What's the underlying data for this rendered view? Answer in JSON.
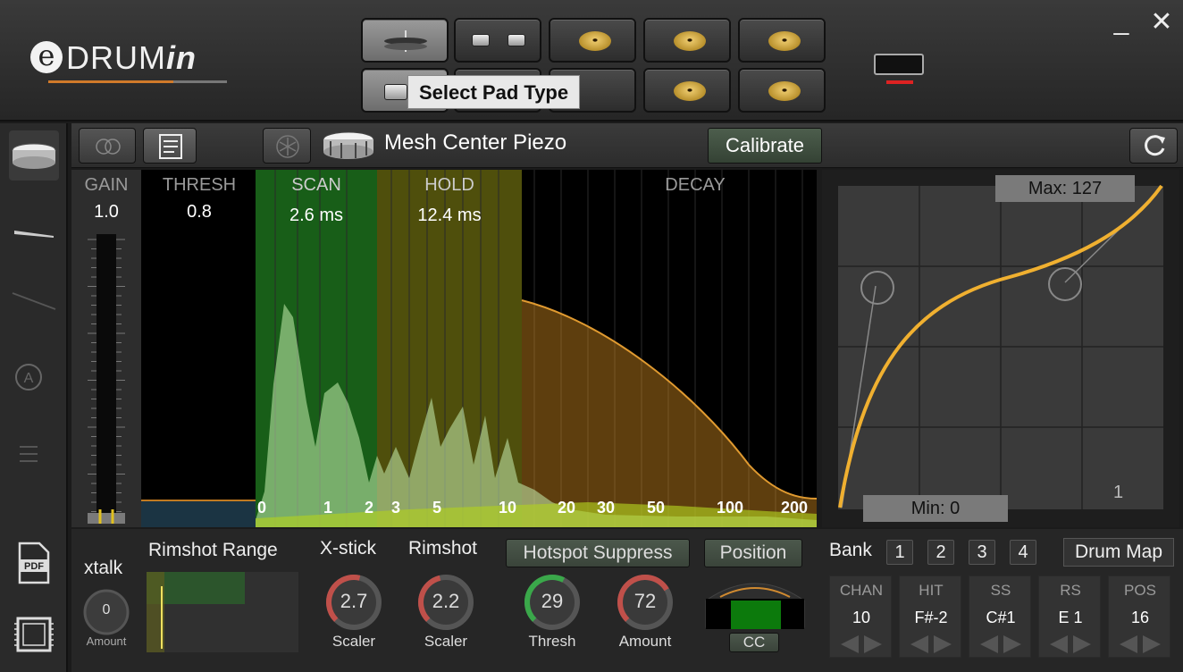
{
  "header": {
    "logo_prefix": "e",
    "logo_main": "DRUM",
    "logo_suffix": "in",
    "tooltip": "Select Pad Type",
    "minimize": "_",
    "close": "✕"
  },
  "toolbar": {
    "drum_name": "Mesh Center Piezo",
    "calibrate_label": "Calibrate"
  },
  "gain": {
    "label": "GAIN",
    "value": "1.0"
  },
  "scan_graph": {
    "sections": [
      {
        "label": "THRESH",
        "value": "0.8"
      },
      {
        "label": "SCAN",
        "value": "2.6 ms"
      },
      {
        "label": "HOLD",
        "value": "12.4 ms"
      },
      {
        "label": "DECAY",
        "value": ""
      }
    ],
    "axis_ticks": [
      "0",
      "1",
      "2",
      "3",
      "5",
      "10",
      "20",
      "30",
      "50",
      "100",
      "200"
    ],
    "colors": {
      "scan": "#1c6e1c",
      "hold": "#6a6a10",
      "decay": "#d08a20"
    }
  },
  "curve": {
    "max_label": "Max: 127",
    "min_label": "Min: 0",
    "corner_value": "1",
    "curve_color": "#f0b030"
  },
  "bottom": {
    "rimshot_range_label": "Rimshot Range",
    "xstick_label": "X-stick",
    "rimshot_label": "Rimshot",
    "hotspot_label": "Hotspot Suppress",
    "position_label": "Position",
    "xtalk_label": "xtalk",
    "xtalk_value": "0",
    "xtalk_sub": "Amount",
    "knobs": [
      {
        "value": "2.7",
        "label": "Scaler"
      },
      {
        "value": "2.2",
        "label": "Scaler"
      },
      {
        "value": "29",
        "label": "Thresh"
      },
      {
        "value": "72",
        "label": "Amount"
      }
    ],
    "cc_label": "CC"
  },
  "bank": {
    "label": "Bank",
    "buttons": [
      "1",
      "2",
      "3",
      "4"
    ],
    "drum_map_label": "Drum Map",
    "columns": [
      {
        "header": "CHAN",
        "value": "10"
      },
      {
        "header": "HIT",
        "value": "F#-2"
      },
      {
        "header": "SS",
        "value": "C#1"
      },
      {
        "header": "RS",
        "value": "E 1"
      },
      {
        "header": "POS",
        "value": "16"
      }
    ]
  },
  "sidebar": {
    "pdf_label": "PDF"
  }
}
